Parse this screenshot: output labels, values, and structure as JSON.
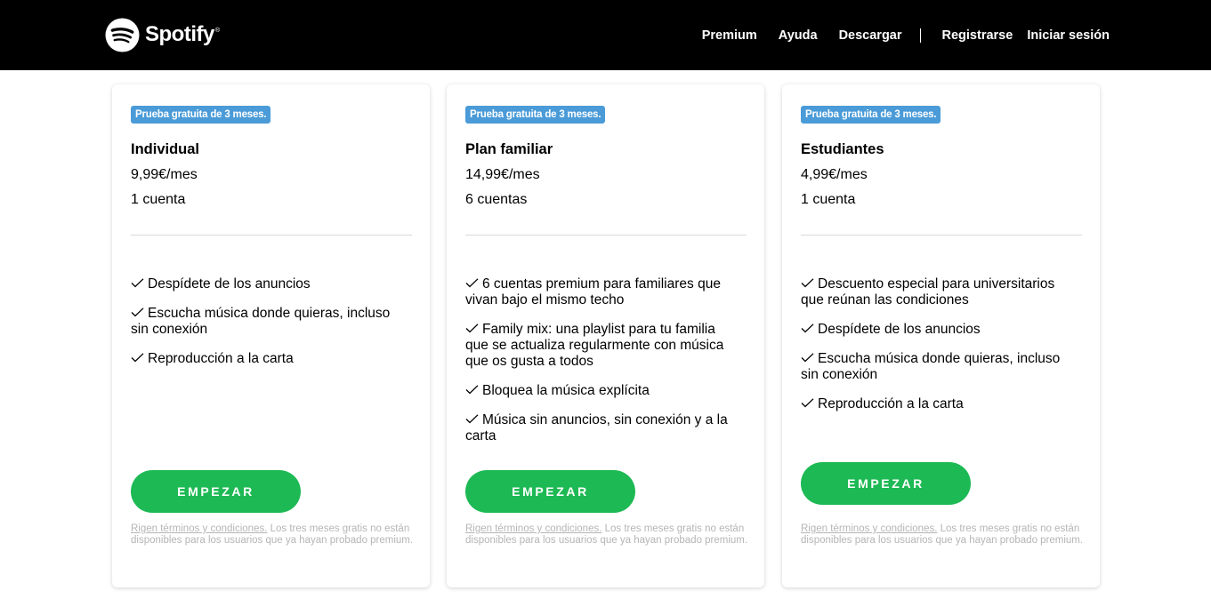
{
  "header": {
    "logo_text": "Spotify",
    "logo_reg": "®",
    "nav": [
      "Premium",
      "Ayuda",
      "Descargar"
    ],
    "register": "Registrarse",
    "login": "Iniciar sesión"
  },
  "colors": {
    "topbar": "#000000",
    "badge": "#4a9bd8",
    "cta": "#1db954",
    "terms_text": "#b5b5b5"
  },
  "plans": [
    {
      "badge": "Prueba gratuita de 3 meses.",
      "name": "Individual",
      "price": "9,99€/mes",
      "accounts": "1 cuenta",
      "features": [
        "Despídete de los anuncios",
        "Escucha música donde quieras, incluso sin conexión",
        "Reproducción a la carta"
      ],
      "cta": "EMPEZAR",
      "terms_link": "Rigen términos y condiciones.",
      "terms_text": " Los tres meses gratis no están disponibles para los usuarios que ya hayan probado premium."
    },
    {
      "badge": "Prueba gratuita de 3 meses.",
      "name": "Plan familiar",
      "price": "14,99€/mes",
      "accounts": "6 cuentas",
      "features": [
        "6 cuentas premium para familiares que vivan bajo el mismo techo",
        "Family mix: una playlist para tu familia que se actualiza regularmente con música que os gusta a todos",
        "Bloquea la música explícita",
        "Música sin anuncios, sin conexión y a la carta"
      ],
      "cta": "EMPEZAR",
      "terms_link": "Rigen términos y condiciones.",
      "terms_text": " Los tres meses gratis no están disponibles para los usuarios que ya hayan probado premium."
    },
    {
      "badge": "Prueba gratuita de 3 meses.",
      "name": "Estudiantes",
      "price": "4,99€/mes",
      "accounts": "1 cuenta",
      "features": [
        "Descuento especial para universitarios que reúnan las condiciones",
        "Despídete de los anuncios",
        "Escucha música donde quieras, incluso sin conexión",
        "Reproducción a la carta"
      ],
      "cta": "EMPEZAR",
      "terms_link": "Rigen términos y condiciones.",
      "terms_text": " Los tres meses gratis no están disponibles para los usuarios que ya hayan probado premium."
    }
  ]
}
